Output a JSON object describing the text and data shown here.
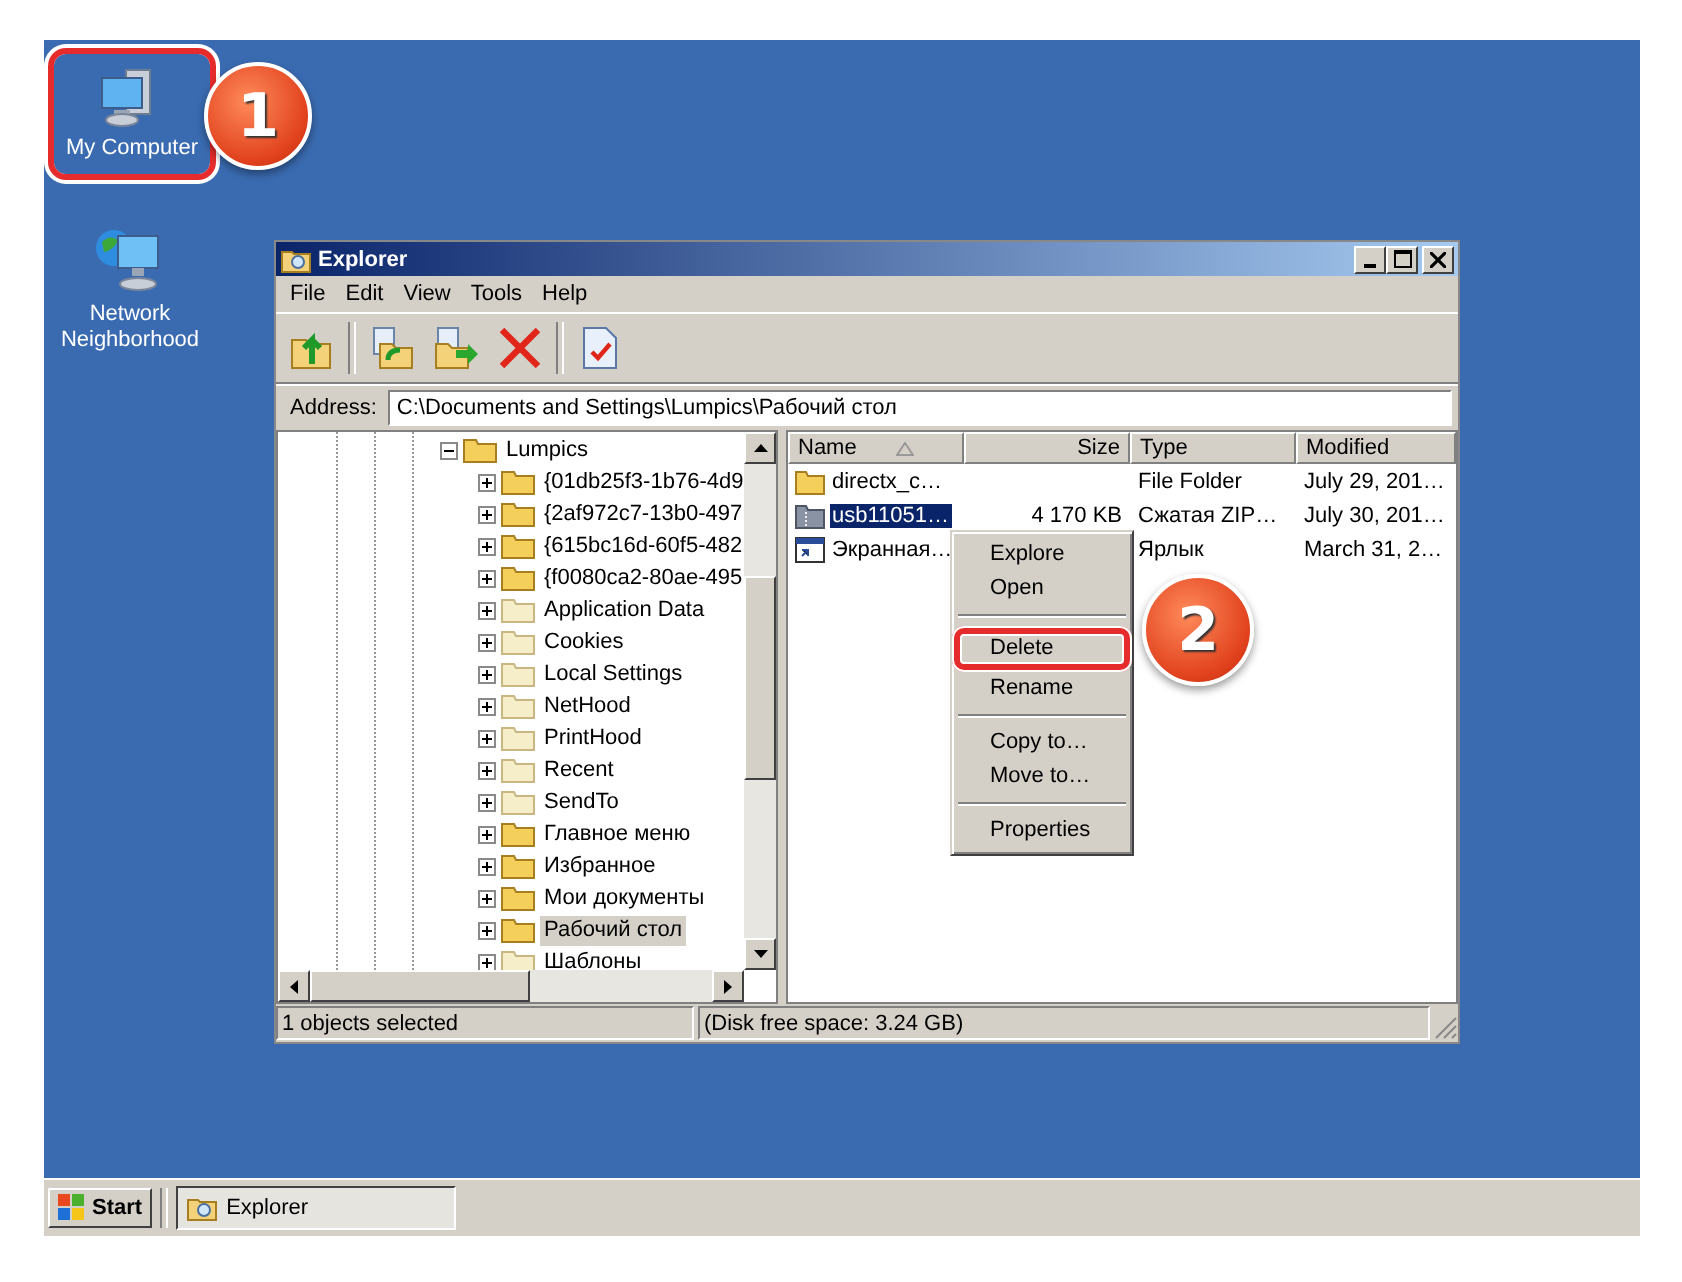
{
  "desktop_icons": [
    {
      "label": "My Computer",
      "kind": "computer",
      "highlighted": true
    },
    {
      "label": "Network Neighborhood",
      "kind": "network",
      "highlighted": false
    }
  ],
  "window": {
    "title": "Explorer"
  },
  "menu_bar": [
    "File",
    "Edit",
    "View",
    "Tools",
    "Help"
  ],
  "address": {
    "label": "Address:",
    "value": "C:\\Documents and Settings\\Lumpics\\Рабочий стол"
  },
  "tree": [
    {
      "label": "Lumpics",
      "expanded": true,
      "hidden": false,
      "selected": false,
      "children": [
        {
          "label": "{01db25f3-1b76-4d9",
          "expanded": false,
          "hidden": false,
          "selected": false
        },
        {
          "label": "{2af972c7-13b0-497",
          "expanded": false,
          "hidden": false,
          "selected": false
        },
        {
          "label": "{615bc16d-60f5-482",
          "expanded": false,
          "hidden": false,
          "selected": false
        },
        {
          "label": "{f0080ca2-80ae-495",
          "expanded": false,
          "hidden": false,
          "selected": false
        },
        {
          "label": "Application Data",
          "expanded": false,
          "hidden": true,
          "selected": false
        },
        {
          "label": "Cookies",
          "expanded": false,
          "hidden": true,
          "selected": false
        },
        {
          "label": "Local Settings",
          "expanded": false,
          "hidden": true,
          "selected": false
        },
        {
          "label": "NetHood",
          "expanded": false,
          "hidden": true,
          "selected": false
        },
        {
          "label": "PrintHood",
          "expanded": false,
          "hidden": true,
          "selected": false
        },
        {
          "label": "Recent",
          "expanded": false,
          "hidden": true,
          "selected": false
        },
        {
          "label": "SendTo",
          "expanded": false,
          "hidden": true,
          "selected": false
        },
        {
          "label": "Главное меню",
          "expanded": false,
          "hidden": false,
          "selected": false
        },
        {
          "label": "Избранное",
          "expanded": false,
          "hidden": false,
          "selected": false
        },
        {
          "label": "Мои документы",
          "expanded": false,
          "hidden": false,
          "selected": false
        },
        {
          "label": "Рабочий стол",
          "expanded": false,
          "hidden": false,
          "selected": true
        },
        {
          "label": "Шаблоны",
          "expanded": false,
          "hidden": true,
          "selected": false
        }
      ]
    }
  ],
  "file_list": {
    "columns": [
      "Name",
      "Size",
      "Type",
      "Modified"
    ],
    "rows": [
      {
        "kind": "folder",
        "name": "directx_c…",
        "size": "",
        "type": "File Folder",
        "modified": "July 29, 201…",
        "selected": false
      },
      {
        "kind": "archive",
        "name": "usb11051…",
        "size": "4 170 KB",
        "type": "Сжатая ZIP…",
        "modified": "July 30, 201…",
        "selected": true
      },
      {
        "kind": "shortcut",
        "name": "Экранная…",
        "size": "",
        "type": "Ярлык",
        "modified": "March 31, 2…",
        "selected": false
      }
    ]
  },
  "context_menu": [
    {
      "kind": "item",
      "label": "Explore",
      "highlighted": false
    },
    {
      "kind": "item",
      "label": "Open",
      "highlighted": false
    },
    {
      "kind": "separator"
    },
    {
      "kind": "item",
      "label": "Delete",
      "highlighted": true
    },
    {
      "kind": "item",
      "label": "Rename",
      "highlighted": false
    },
    {
      "kind": "separator"
    },
    {
      "kind": "item",
      "label": "Copy to…",
      "highlighted": false
    },
    {
      "kind": "item",
      "label": "Move to…",
      "highlighted": false
    },
    {
      "kind": "separator"
    },
    {
      "kind": "item",
      "label": "Properties",
      "highlighted": false
    }
  ],
  "status_bar": [
    "1 objects selected",
    "(Disk free space: 3.24 GB)"
  ],
  "callouts": [
    "1",
    "2"
  ],
  "taskbar": {
    "start": "Start",
    "tasks": [
      {
        "label": "Explorer",
        "selected": true
      }
    ]
  }
}
